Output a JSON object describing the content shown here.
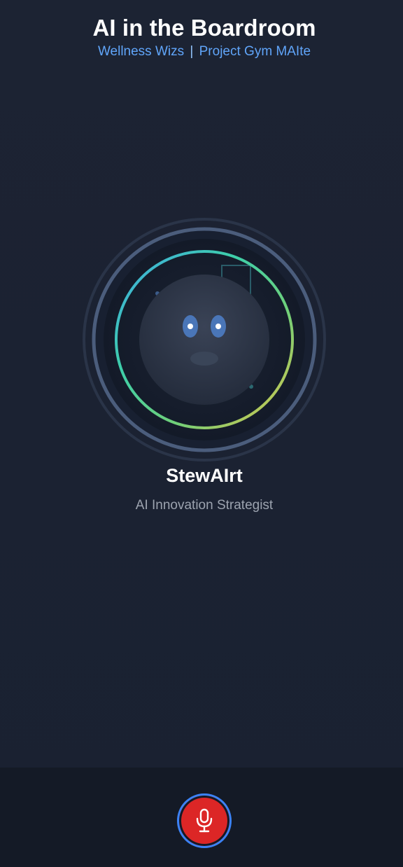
{
  "header": {
    "title": "AI in the Boardroom",
    "team": "Wellness Wizs",
    "separator": "|",
    "project": "Project Gym MAIte"
  },
  "agent": {
    "name": "StewAIrt",
    "role": "AI Innovation Strategist",
    "avatar_icon": "robot-face-icon",
    "ring_colors": [
      "#3fb8e0",
      "#3ecfa0",
      "#7ccf6a",
      "#d6c24a"
    ]
  },
  "footer": {
    "mic_icon": "microphone-icon",
    "mic_button_color": "#dc2626",
    "mic_button_border": "#3b82f6"
  },
  "colors": {
    "background": "#1b2232",
    "footer_background": "#141a26",
    "accent": "#60a5fa"
  }
}
